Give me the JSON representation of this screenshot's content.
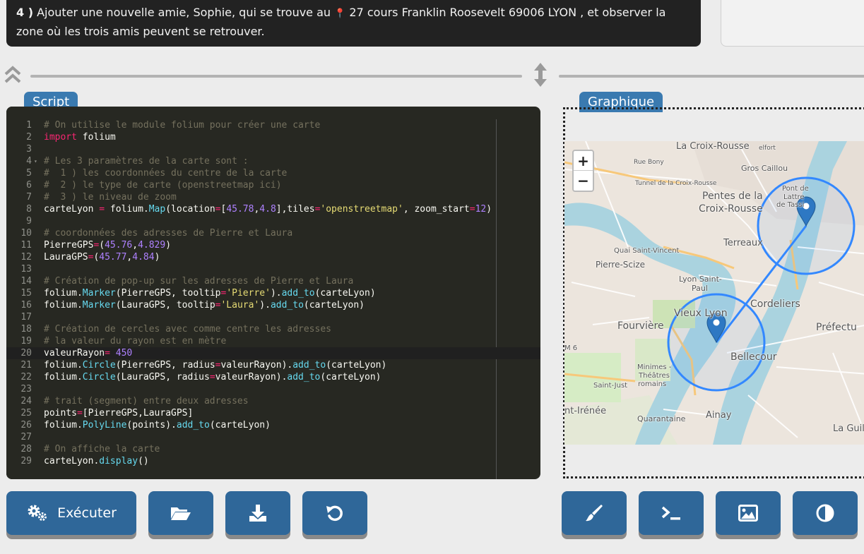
{
  "instruction": {
    "number": "4 )",
    "text_before": "Ajouter une nouvelle amie, Sophie, qui se trouve au",
    "pin_glyph": "📍",
    "text_after": "27 cours Franklin Roosevelt 69006 LYON , et observer la zone où les trois amis peuvent se retrouver."
  },
  "tabs": {
    "script": "Script",
    "graph": "Graphique"
  },
  "code_lines": [
    {
      "n": "1",
      "html": "<span class=\"c\"># On utilise le module folium pour créer une carte</span>"
    },
    {
      "n": "2",
      "html": "<span class=\"k\">import</span> folium"
    },
    {
      "n": "3",
      "html": ""
    },
    {
      "n": "4",
      "fold": true,
      "html": "<span class=\"c\"># Les 3 paramètres de la carte sont :</span>"
    },
    {
      "n": "5",
      "html": "<span class=\"c\">#  1 ) les coordonnées du centre de la carte</span>"
    },
    {
      "n": "6",
      "html": "<span class=\"c\">#  2 ) le type de carte (openstreetmap ici)</span>"
    },
    {
      "n": "7",
      "html": "<span class=\"c\">#  3 ) le niveau de zoom</span>"
    },
    {
      "n": "8",
      "html": "carteLyon <span class=\"o\">=</span> folium.<span class=\"f\">Map</span>(location<span class=\"o\">=</span>[<span class=\"n\">45.78</span>,<span class=\"n\">4.8</span>],tiles<span class=\"o\">=</span><span class=\"s\">'openstreetmap'</span>, zoom_start<span class=\"o\">=</span><span class=\"n\">12</span>)"
    },
    {
      "n": "9",
      "html": ""
    },
    {
      "n": "10",
      "html": "<span class=\"c\"># coordonnées des adresses de Pierre et Laura</span>"
    },
    {
      "n": "11",
      "html": "PierreGPS<span class=\"o\">=</span>(<span class=\"n\">45.76</span>,<span class=\"n\">4.829</span>)"
    },
    {
      "n": "12",
      "html": "LauraGPS<span class=\"o\">=</span>(<span class=\"n\">45.77</span>,<span class=\"n\">4.84</span>)"
    },
    {
      "n": "13",
      "html": ""
    },
    {
      "n": "14",
      "html": "<span class=\"c\"># Création de pop-up sur les adresses de Pierre et Laura</span>"
    },
    {
      "n": "15",
      "html": "folium.<span class=\"f\">Marker</span>(PierreGPS, tooltip<span class=\"o\">=</span><span class=\"s\">'Pierre'</span>).<span class=\"f\">add_to</span>(carteLyon)"
    },
    {
      "n": "16",
      "html": "folium.<span class=\"f\">Marker</span>(LauraGPS, tooltip<span class=\"o\">=</span><span class=\"s\">'Laura'</span>).<span class=\"f\">add_to</span>(carteLyon)"
    },
    {
      "n": "17",
      "html": ""
    },
    {
      "n": "18",
      "html": "<span class=\"c\"># Création de cercles avec comme centre les adresses</span>"
    },
    {
      "n": "19",
      "html": "<span class=\"c\"># la valeur du rayon est en mètre</span>"
    },
    {
      "n": "20",
      "active": true,
      "html": "valeurRayon<span class=\"o\">=</span> <span class=\"n\">450</span>"
    },
    {
      "n": "21",
      "html": "folium.<span class=\"f\">Circle</span>(PierreGPS, radius<span class=\"o\">=</span>valeurRayon).<span class=\"f\">add_to</span>(carteLyon)"
    },
    {
      "n": "22",
      "html": "folium.<span class=\"f\">Circle</span>(LauraGPS, radius<span class=\"o\">=</span>valeurRayon).<span class=\"f\">add_to</span>(carteLyon)"
    },
    {
      "n": "23",
      "html": ""
    },
    {
      "n": "24",
      "html": "<span class=\"c\"># trait (segment) entre deux adresses</span>"
    },
    {
      "n": "25",
      "html": "points<span class=\"o\">=</span>[PierreGPS,LauraGPS]"
    },
    {
      "n": "26",
      "html": "folium.<span class=\"f\">PolyLine</span>(points).<span class=\"f\">add_to</span>(carteLyon)"
    },
    {
      "n": "27",
      "html": ""
    },
    {
      "n": "28",
      "html": "<span class=\"c\"># On affiche la carte</span>"
    },
    {
      "n": "29",
      "html": "carteLyon.<span class=\"f\">display</span>()"
    }
  ],
  "map": {
    "zoom_in": "+",
    "zoom_out": "−",
    "labels": [
      "La Croix-Rousse",
      "Gros Caillou",
      "Pentes de la",
      "Croix-Rousse",
      "Terreaux",
      "Pont de",
      "Lattre",
      "de Tassi",
      "Pierre-Scize",
      "Quai Saint-Vincent",
      "Lyon Saint-",
      "Paul",
      "Vieux Lyon",
      "Cordeliers",
      "Fourvière",
      "Bellecour",
      "Préfectu",
      "Minimes -",
      "Théâtres",
      "romains",
      "Saint-Just",
      "nt-Irénée",
      "Quarantaine",
      "Ainay",
      "La Guillo",
      "Tunnel de la Croix-Rousse",
      "Rue Bony",
      "elfort",
      "M 6"
    ]
  },
  "buttons": {
    "run": "Exécuter"
  },
  "colors": {
    "accent": "#3a7ab0",
    "button": "#2f6799",
    "editor_bg": "#272822",
    "marker": "#2e78c3",
    "circle": "#3388ff"
  }
}
